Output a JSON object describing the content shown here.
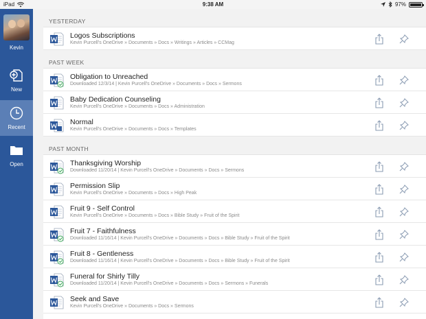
{
  "status_bar": {
    "device": "iPad",
    "time": "9:38 AM",
    "battery": "97%",
    "battery_level": 0.97
  },
  "sidebar": {
    "user_name": "Kevin",
    "items": [
      {
        "label": "New",
        "icon": "new-document-icon"
      },
      {
        "label": "Recent",
        "icon": "clock-icon",
        "active": true
      },
      {
        "label": "Open",
        "icon": "folder-icon"
      }
    ]
  },
  "sections": [
    {
      "header": "YESTERDAY",
      "files": [
        {
          "title": "Logos Subscriptions",
          "subtitle": "Kevin Purcell's OneDrive » Documents » Docs » Writings » Articles » CCMag",
          "synced": false
        }
      ]
    },
    {
      "header": "PAST WEEK",
      "files": [
        {
          "title": "Obligation to Unreached",
          "subtitle": "Downloaded 12/3/14 | Kevin Purcell's OneDrive » Documents » Docs » Sermons",
          "synced": true
        },
        {
          "title": "Baby Dedication Counseling",
          "subtitle": "Kevin Purcell's OneDrive » Documents » Docs » Administration",
          "synced": false
        },
        {
          "title": "Normal",
          "subtitle": "Kevin Purcell's OneDrive » Documents » Docs » Templates",
          "synced": false,
          "template": true
        }
      ]
    },
    {
      "header": "PAST MONTH",
      "files": [
        {
          "title": "Thanksgiving Worship",
          "subtitle": "Downloaded 11/20/14 | Kevin Purcell's OneDrive » Documents » Docs » Sermons",
          "synced": true
        },
        {
          "title": "Permission Slip",
          "subtitle": "Kevin Purcell's OneDrive » Documents » Docs » High Peak",
          "synced": false
        },
        {
          "title": "Fruit 9 - Self Control",
          "subtitle": "Kevin Purcell's OneDrive » Documents » Docs » Bible Study » Fruit of the Spirit",
          "synced": false
        },
        {
          "title": "Fruit 7 - Faithfulness",
          "subtitle": "Downloaded 11/16/14 | Kevin Purcell's OneDrive » Documents » Docs » Bible Study » Fruit of the Spirit",
          "synced": true
        },
        {
          "title": "Fruit 8 - Gentleness",
          "subtitle": "Downloaded 11/16/14 | Kevin Purcell's OneDrive » Documents » Docs » Bible Study » Fruit of the Spirit",
          "synced": true
        },
        {
          "title": "Funeral for Shirly Tilly",
          "subtitle": "Downloaded 11/20/14 | Kevin Purcell's OneDrive » Documents » Docs » Sermons » Funerals",
          "synced": true
        },
        {
          "title": "Seek and Save",
          "subtitle": "Kevin Purcell's OneDrive » Documents » Docs » Sermons",
          "synced": false
        }
      ]
    }
  ],
  "colors": {
    "sidebar": "#2b579a",
    "sidebar_active": "#5b7fb6",
    "word_blue": "#2b579a",
    "sync_green": "#3aa757"
  }
}
